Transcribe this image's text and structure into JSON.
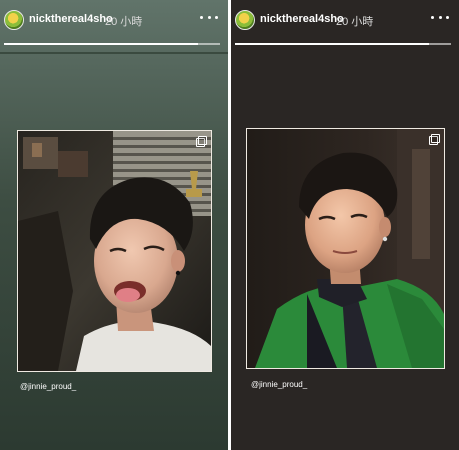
{
  "stories": [
    {
      "username": "nickthereal4sho",
      "time": "20 小時",
      "mention": "@jinnie_proud_",
      "progress": 0.9,
      "icons": {
        "avatar": "profile-avatar",
        "more": "more-horizontal-icon",
        "multi": "multiple-photos-icon"
      }
    },
    {
      "username": "nickthereal4sho",
      "time": "20 小時",
      "mention": "@jinnie_proud_",
      "progress": 0.9,
      "icons": {
        "avatar": "profile-avatar",
        "more": "more-horizontal-icon",
        "multi": "multiple-photos-icon"
      }
    }
  ],
  "colors": {
    "story1_bg": "#4a5b50",
    "story2_bg": "#2a2624",
    "shirt_green": "#2b8a3a"
  }
}
